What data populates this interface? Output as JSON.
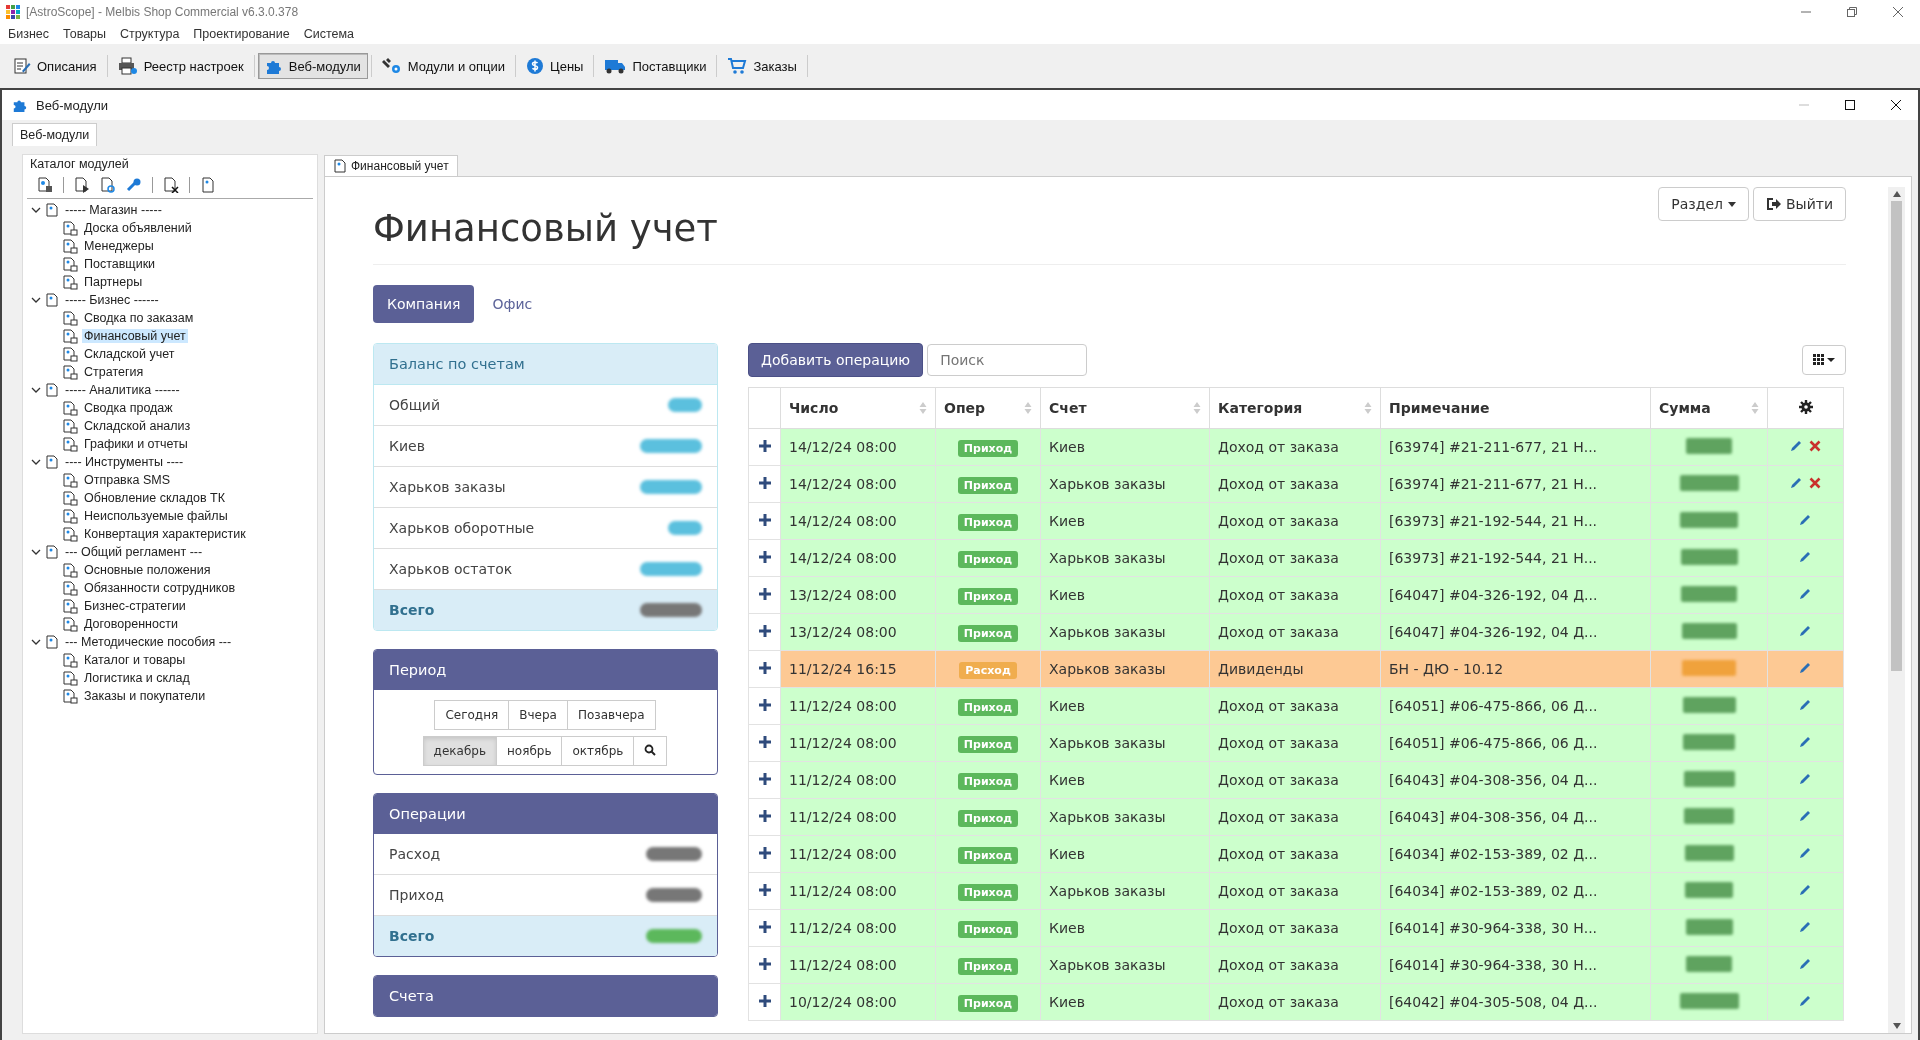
{
  "window": {
    "title": "[AstroScope] - Melbis Shop Commercial v6.3.0.378"
  },
  "menu": [
    "Бизнес",
    "Товары",
    "Структура",
    "Проектирование",
    "Система"
  ],
  "toolbar": [
    {
      "label": "Описания",
      "selected": false
    },
    {
      "label": "Реестр настроек",
      "selected": false
    },
    {
      "label": "Веб-модули",
      "selected": true
    },
    {
      "label": "Модули и опции",
      "selected": false
    },
    {
      "label": "Цены",
      "selected": false
    },
    {
      "label": "Поставщики",
      "selected": false
    },
    {
      "label": "Заказы",
      "selected": false
    }
  ],
  "child_window": {
    "title": "Веб-модули",
    "tab": "Веб-модули"
  },
  "catalog": {
    "title": "Каталог модулей",
    "tree": [
      {
        "label": "----- Магазин -----",
        "expanded": true,
        "selected": false,
        "children": [
          {
            "label": "Доска объявлений",
            "selected": false
          },
          {
            "label": "Менеджеры",
            "selected": false
          },
          {
            "label": "Поставщики",
            "selected": false
          },
          {
            "label": "Партнеры",
            "selected": false
          }
        ]
      },
      {
        "label": "----- Бизнес ------",
        "expanded": true,
        "selected": false,
        "children": [
          {
            "label": "Сводка по заказам",
            "selected": false
          },
          {
            "label": "Финансовый учет",
            "selected": true
          },
          {
            "label": "Складской учет",
            "selected": false
          },
          {
            "label": "Стратегия",
            "selected": false
          }
        ]
      },
      {
        "label": "----- Аналитика ------",
        "expanded": true,
        "selected": false,
        "children": [
          {
            "label": "Сводка продаж",
            "selected": false
          },
          {
            "label": "Складской анализ",
            "selected": false
          },
          {
            "label": "Графики и отчеты",
            "selected": false
          }
        ]
      },
      {
        "label": "---- Инструменты ----",
        "expanded": true,
        "selected": false,
        "children": [
          {
            "label": "Отправка SMS",
            "selected": false
          },
          {
            "label": "Обновление складов ТК",
            "selected": false
          },
          {
            "label": "Неиспользуемые файлы",
            "selected": false
          },
          {
            "label": "Конвертация характеристик",
            "selected": false
          }
        ]
      },
      {
        "label": "--- Общий регламент ---",
        "expanded": true,
        "selected": false,
        "children": [
          {
            "label": "Основные положения",
            "selected": false
          },
          {
            "label": "Обязанности сотрудников",
            "selected": false
          },
          {
            "label": "Бизнес-стратегии",
            "selected": false
          },
          {
            "label": "Договоренности",
            "selected": false
          }
        ]
      },
      {
        "label": "--- Методические пособия ---",
        "expanded": true,
        "selected": false,
        "children": [
          {
            "label": "Каталог и товары",
            "selected": false
          },
          {
            "label": "Логистика и склад",
            "selected": false
          },
          {
            "label": "Заказы и покупатели",
            "selected": false
          }
        ]
      }
    ]
  },
  "doc_tab": "Финансовый учет",
  "page": {
    "heading": "Финансовый учет",
    "section_button": "Раздел",
    "exit_button": "Выйти",
    "tabs": [
      {
        "label": "Компания",
        "selected": true
      },
      {
        "label": "Офис",
        "selected": false
      }
    ]
  },
  "balance": {
    "title": "Баланс по счетам",
    "rows": [
      {
        "label": "Общий",
        "kind": "account",
        "color": "#5bc0de"
      },
      {
        "label": "Киев",
        "kind": "account",
        "color": "#5bc0de"
      },
      {
        "label": "Харьков заказы",
        "kind": "account",
        "color": "#5bc0de"
      },
      {
        "label": "Харьков оборотные",
        "kind": "account",
        "color": "#5bc0de"
      },
      {
        "label": "Харьков остаток",
        "kind": "account",
        "color": "#5bc0de"
      },
      {
        "label": "Всего",
        "kind": "total",
        "color": "#777777"
      }
    ]
  },
  "period": {
    "title": "Период",
    "days": [
      {
        "label": "Сегодня",
        "selected": false
      },
      {
        "label": "Вчера",
        "selected": false
      },
      {
        "label": "Позавчера",
        "selected": false
      }
    ],
    "months": [
      {
        "label": "декабрь",
        "selected": true
      },
      {
        "label": "ноябрь",
        "selected": false
      },
      {
        "label": "октябрь",
        "selected": false
      }
    ]
  },
  "operations": {
    "title": "Операции",
    "rows": [
      {
        "label": "Расход",
        "kind": "account",
        "color": "#777777"
      },
      {
        "label": "Приход",
        "kind": "account",
        "color": "#777777"
      },
      {
        "label": "Всего",
        "kind": "total",
        "color": "#5cb85c"
      }
    ]
  },
  "accounts": {
    "title": "Счета"
  },
  "table": {
    "add_button": "Добавить операцию",
    "search": {
      "placeholder": "Поиск"
    },
    "columns": [
      {
        "label": "Число",
        "sortable": true
      },
      {
        "label": "Опер",
        "sortable": true
      },
      {
        "label": "Счет",
        "sortable": true
      },
      {
        "label": "Категория",
        "sortable": true
      },
      {
        "label": "Примечание",
        "sortable": false
      },
      {
        "label": "Сумма",
        "sortable": true
      }
    ],
    "rows": [
      {
        "date": "14/12/24 08:00",
        "kind": "income",
        "op": "Приход",
        "account": "Киев",
        "category": "Доход от заказа",
        "note": "[63974] #21-211-677, 21 Н...",
        "deletable": true
      },
      {
        "date": "14/12/24 08:00",
        "kind": "income",
        "op": "Приход",
        "account": "Харьков заказы",
        "category": "Доход от заказа",
        "note": "[63974] #21-211-677, 21 Н...",
        "deletable": true
      },
      {
        "date": "14/12/24 08:00",
        "kind": "income",
        "op": "Приход",
        "account": "Киев",
        "category": "Доход от заказа",
        "note": "[63973] #21-192-544, 21 Н...",
        "deletable": false
      },
      {
        "date": "14/12/24 08:00",
        "kind": "income",
        "op": "Приход",
        "account": "Харьков заказы",
        "category": "Доход от заказа",
        "note": "[63973] #21-192-544, 21 Н...",
        "deletable": false
      },
      {
        "date": "13/12/24 08:00",
        "kind": "income",
        "op": "Приход",
        "account": "Киев",
        "category": "Доход от заказа",
        "note": "[64047] #04-326-192, 04 Д...",
        "deletable": false
      },
      {
        "date": "13/12/24 08:00",
        "kind": "income",
        "op": "Приход",
        "account": "Харьков заказы",
        "category": "Доход от заказа",
        "note": "[64047] #04-326-192, 04 Д...",
        "deletable": false
      },
      {
        "date": "11/12/24 16:15",
        "kind": "expense",
        "op": "Расход",
        "account": "Харьков заказы",
        "category": "Дивиденды",
        "note": "БН - ДЮ - 10.12",
        "deletable": false
      },
      {
        "date": "11/12/24 08:00",
        "kind": "income",
        "op": "Приход",
        "account": "Киев",
        "category": "Доход от заказа",
        "note": "[64051] #06-475-866, 06 Д...",
        "deletable": false
      },
      {
        "date": "11/12/24 08:00",
        "kind": "income",
        "op": "Приход",
        "account": "Харьков заказы",
        "category": "Доход от заказа",
        "note": "[64051] #06-475-866, 06 Д...",
        "deletable": false
      },
      {
        "date": "11/12/24 08:00",
        "kind": "income",
        "op": "Приход",
        "account": "Киев",
        "category": "Доход от заказа",
        "note": "[64043] #04-308-356, 04 Д...",
        "deletable": false
      },
      {
        "date": "11/12/24 08:00",
        "kind": "income",
        "op": "Приход",
        "account": "Харьков заказы",
        "category": "Доход от заказа",
        "note": "[64043] #04-308-356, 04 Д...",
        "deletable": false
      },
      {
        "date": "11/12/24 08:00",
        "kind": "income",
        "op": "Приход",
        "account": "Киев",
        "category": "Доход от заказа",
        "note": "[64034] #02-153-389, 02 Д...",
        "deletable": false
      },
      {
        "date": "11/12/24 08:00",
        "kind": "income",
        "op": "Приход",
        "account": "Харьков заказы",
        "category": "Доход от заказа",
        "note": "[64034] #02-153-389, 02 Д...",
        "deletable": false
      },
      {
        "date": "11/12/24 08:00",
        "kind": "income",
        "op": "Приход",
        "account": "Киев",
        "category": "Доход от заказа",
        "note": "[64014] #30-964-338, 30 Н...",
        "deletable": false
      },
      {
        "date": "11/12/24 08:00",
        "kind": "income",
        "op": "Приход",
        "account": "Харьков заказы",
        "category": "Доход от заказа",
        "note": "[64014] #30-964-338, 30 Н...",
        "deletable": false
      },
      {
        "date": "10/12/24 08:00",
        "kind": "income",
        "op": "Приход",
        "account": "Киев",
        "category": "Доход от заказа",
        "note": "[64042] #04-305-508, 04 Д...",
        "deletable": false
      }
    ]
  }
}
